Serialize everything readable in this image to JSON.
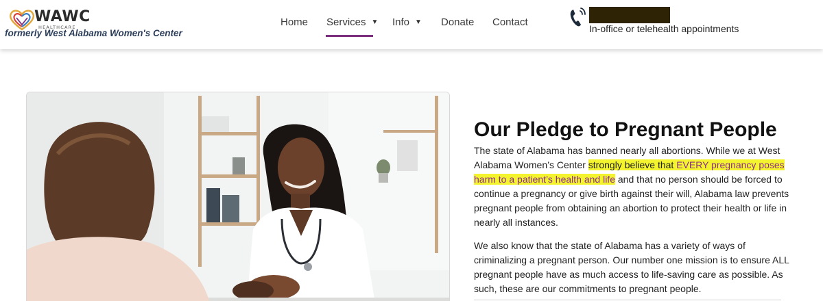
{
  "header": {
    "logo": {
      "brand": "WAWC",
      "sub": "HEALTHCARE",
      "formerly": "formerly West Alabama Women's Center"
    },
    "nav": [
      {
        "label": "Home",
        "has_dropdown": false,
        "active": false
      },
      {
        "label": "Services",
        "has_dropdown": true,
        "active": true
      },
      {
        "label": "Info",
        "has_dropdown": true,
        "active": false
      },
      {
        "label": "Donate",
        "has_dropdown": false,
        "active": false
      },
      {
        "label": "Contact",
        "has_dropdown": false,
        "active": false
      }
    ],
    "phone": {
      "icon": "phone-ringing-icon",
      "subtext": "In-office or telehealth appointments"
    }
  },
  "main": {
    "heading": "Our Pledge to Pregnant People",
    "para1": {
      "before": "The state of Alabama has banned nearly all abortions. While we at West Alabama Women’s Center ",
      "highlight_a": "strongly believe that ",
      "highlight_b": "EVERY pregnancy poses harm to a patient’s health and life",
      "after": " and that no person should be forced to continue a pregnancy or give birth against their will, Alabama law prevents pregnant people from obtaining an abortion to protect their health or life in nearly all instances."
    },
    "para2": "We also know that the state of Alabama has a variety of ways of criminalizing a pregnant person. Our number one mission is to ensure ALL pregnant people have as much access to life-saving care as possible. As such, these are our commitments to pregnant people."
  },
  "colors": {
    "accent_purple": "#7b2f7f",
    "highlight_yellow": "#f4f42e",
    "redaction": "#2e2405"
  }
}
